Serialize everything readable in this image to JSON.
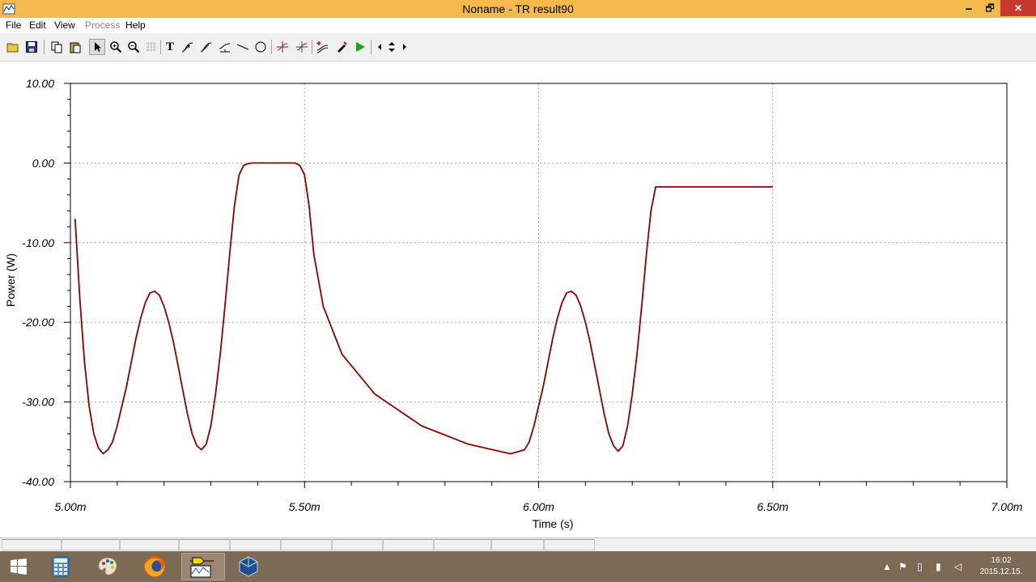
{
  "window": {
    "title": "Noname - TR result90",
    "minimize_glyph": "🗕",
    "maximize_glyph": "🗗",
    "close_glyph": "✕"
  },
  "menu": [
    {
      "label": "File",
      "enabled": true
    },
    {
      "label": "Edit",
      "enabled": true
    },
    {
      "label": "View",
      "enabled": true
    },
    {
      "label": "Process",
      "enabled": false
    },
    {
      "label": "Help",
      "enabled": true
    }
  ],
  "toolbar": {
    "text_tool_glyph": "T",
    "icons": [
      "open-icon",
      "save-icon",
      "copy-icon",
      "paste-icon",
      "pointer-icon",
      "zoom-in-icon",
      "zoom-out-icon",
      "grid-icon",
      "text-icon",
      "curve-label-icon",
      "curve-label-2-icon",
      "curve-label-3-icon",
      "line-icon",
      "circle-icon",
      "cursor-a-icon",
      "cursor-b-icon",
      "add-curve-icon",
      "pen-icon",
      "run-icon",
      "arrow-left-icon",
      "arrow-updown-icon",
      "arrow-right-icon"
    ]
  },
  "chart_data": {
    "type": "line",
    "xlabel": "Time (s)",
    "ylabel": "Power (W)",
    "xlim": [
      5.0,
      7.0
    ],
    "ylim": [
      -40,
      10
    ],
    "x_unit": "ms",
    "x_ticks": [
      {
        "value": 5.0,
        "label": "5.00m"
      },
      {
        "value": 5.5,
        "label": "5.50m"
      },
      {
        "value": 6.0,
        "label": "6.00m"
      },
      {
        "value": 6.5,
        "label": "6.50m"
      },
      {
        "value": 7.0,
        "label": "7.00m"
      }
    ],
    "y_ticks": [
      {
        "value": 10,
        "label": "10.00"
      },
      {
        "value": 0,
        "label": "0.00"
      },
      {
        "value": -10,
        "label": "-10.00"
      },
      {
        "value": -20,
        "label": "-20.00"
      },
      {
        "value": -30,
        "label": "-30.00"
      },
      {
        "value": -40,
        "label": "-40.00"
      }
    ],
    "grid": true,
    "series": [
      {
        "color": "#8b0000",
        "x": [
          5.01,
          5.02,
          5.03,
          5.04,
          5.05,
          5.06,
          5.07,
          5.08,
          5.09,
          5.1,
          5.11,
          5.12,
          5.13,
          5.14,
          5.15,
          5.16,
          5.17,
          5.18,
          5.19,
          5.2,
          5.21,
          5.22,
          5.23,
          5.24,
          5.25,
          5.26,
          5.27,
          5.28,
          5.29,
          5.3,
          5.31,
          5.32,
          5.33,
          5.34,
          5.35,
          5.36,
          5.37,
          5.38,
          5.39,
          5.4,
          5.41,
          5.42,
          5.43,
          5.44,
          5.45,
          5.46,
          5.47,
          5.48,
          5.49,
          5.5,
          5.51,
          5.52,
          5.54,
          5.58,
          5.65,
          5.75,
          5.85,
          5.94,
          5.97,
          5.98,
          5.99,
          6.0,
          6.01,
          6.02,
          6.03,
          6.04,
          6.05,
          6.06,
          6.07,
          6.08,
          6.09,
          6.1,
          6.11,
          6.12,
          6.13,
          6.14,
          6.15,
          6.16,
          6.17,
          6.18,
          6.19,
          6.2,
          6.21,
          6.22,
          6.23,
          6.24,
          6.25,
          6.26,
          6.27,
          6.28,
          6.29,
          6.3,
          6.31,
          6.32,
          6.33,
          6.34,
          6.35,
          6.36,
          6.37,
          6.38,
          6.39,
          6.4,
          6.41,
          6.42,
          6.43,
          6.44,
          6.45,
          6.46,
          6.47,
          6.48,
          6.49,
          6.5
        ],
        "y": [
          -7.0,
          -17.0,
          -25.0,
          -30.5,
          -34.0,
          -35.8,
          -36.5,
          -36.0,
          -35.0,
          -33.0,
          -30.5,
          -28.0,
          -25.0,
          -22.0,
          -19.5,
          -17.5,
          -16.3,
          -16.1,
          -16.6,
          -18.0,
          -20.0,
          -22.5,
          -25.5,
          -28.5,
          -31.5,
          -34.0,
          -35.5,
          -36.0,
          -35.3,
          -33.0,
          -29.0,
          -24.0,
          -18.0,
          -11.5,
          -5.5,
          -1.5,
          -0.3,
          -0.05,
          0.0,
          0.0,
          0.0,
          0.0,
          0.0,
          0.0,
          0.0,
          0.0,
          0.0,
          0.0,
          -0.3,
          -1.5,
          -5.5,
          -11.5,
          -18.0,
          -24.0,
          -29.0,
          -33.0,
          -35.3,
          -36.5,
          -36.0,
          -35.0,
          -33.0,
          -30.5,
          -28.0,
          -25.0,
          -22.0,
          -19.5,
          -17.5,
          -16.3,
          -16.1,
          -16.6,
          -18.0,
          -20.0,
          -22.5,
          -25.5,
          -28.5,
          -31.5,
          -34.0,
          -35.5,
          -36.2,
          -35.5,
          -33.0,
          -29.0,
          -24.0,
          -18.0,
          -11.5,
          -6.0,
          -3.0,
          -3.0,
          -3.0,
          -3.0,
          -3.0,
          -3.0,
          -3.0,
          -3.0,
          -3.0,
          -3.0,
          -3.0,
          -3.0,
          -3.0,
          -3.0,
          -3.0,
          -3.0,
          -3.0,
          -3.0,
          -3.0,
          -3.0,
          -3.0,
          -3.0,
          -3.0,
          -3.0,
          -3.0,
          -3.0
        ]
      }
    ]
  },
  "taskbar": {
    "items": [
      {
        "name": "start-button",
        "glyph": "⊞"
      },
      {
        "name": "calculator-app",
        "glyph": "▦"
      },
      {
        "name": "paint-app",
        "glyph": "🎨"
      },
      {
        "name": "firefox-app",
        "glyph": "◉"
      },
      {
        "name": "tina-app",
        "glyph": "⌁"
      },
      {
        "name": "virtualbox-app",
        "glyph": "⬢"
      }
    ],
    "tray": [
      "▲",
      "⚑",
      "▯",
      "▮",
      "◁"
    ],
    "time": "16:02",
    "date": "2015.12.15."
  }
}
